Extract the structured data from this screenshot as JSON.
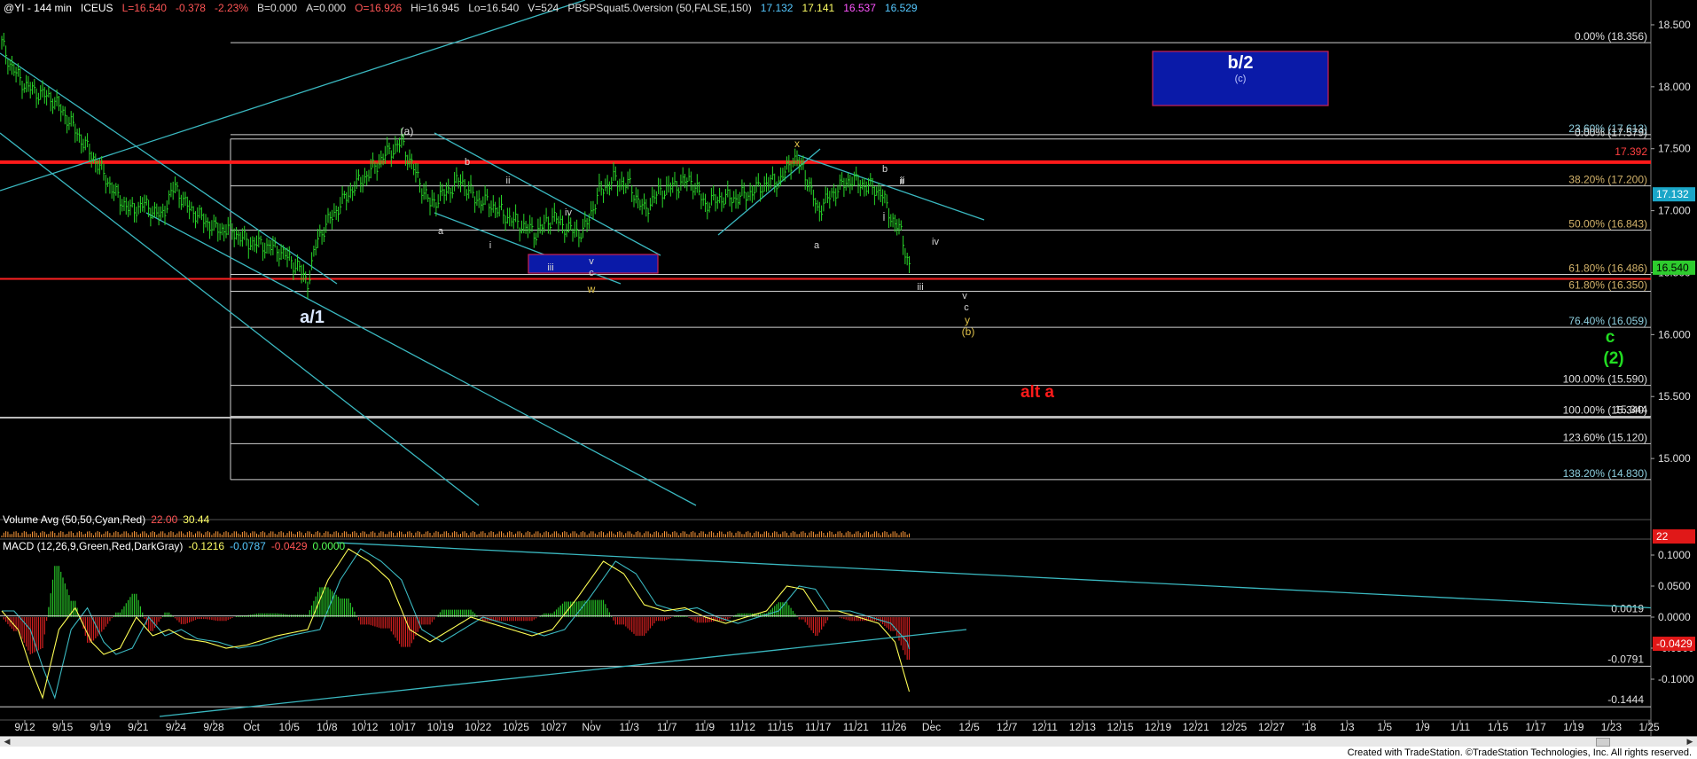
{
  "header": {
    "symbol": "@YI - 144 min",
    "exchange": "ICEUS",
    "last": "L=16.540",
    "change": "-0.378",
    "change_pct": "-2.23%",
    "bid": "B=0.000",
    "ask": "A=0.000",
    "open": "O=16.926",
    "high": "Hi=16.945",
    "low": "Lo=16.540",
    "volume": "V=524",
    "study": "PBSPSquat5.0version (50,FALSE,150)",
    "study_values": [
      "17.132",
      "17.141",
      "16.537",
      "16.529"
    ],
    "study_colors": [
      "#55c8ff",
      "#ffff66",
      "#ff55ff",
      "#55c8ff"
    ]
  },
  "volume_panel": {
    "title": "Volume Avg (50,50,Cyan,Red)",
    "value1": "22.00",
    "value2": "30.44",
    "axis_badge": "22"
  },
  "macd_panel": {
    "title": "MACD (12,26,9,Green,Red,DarkGray)",
    "value1": "-0.1216",
    "value2": "-0.0787",
    "value3": "-0.0429",
    "value4": "0.0000"
  },
  "price_axis": {
    "ticks": [
      "18.500",
      "18.000",
      "17.500",
      "17.000",
      "16.500",
      "16.000",
      "15.500",
      "15.000"
    ],
    "current_badge": "17.132",
    "last_badge": "16.540"
  },
  "macd_axis": {
    "ticks": [
      "0.1000",
      "0.0500",
      "0.0000",
      "-0.0500",
      "-0.1000"
    ],
    "badge": "-0.0429"
  },
  "fib_levels": [
    {
      "label": "0.00% (18.356)",
      "price": 18.356
    },
    {
      "label": "23.60% (17.613)",
      "price": 17.613
    },
    {
      "label": "0.00% (17.579)",
      "price": 17.579
    },
    {
      "label": "38.20% (17.200)",
      "price": 17.2
    },
    {
      "label": "50.00% (16.843)",
      "price": 16.843
    },
    {
      "label": "61.80% (16.486)",
      "price": 16.486
    },
    {
      "label": "61.80% (16.350)",
      "price": 16.35
    },
    {
      "label": "76.40% (16.059)",
      "price": 16.059
    },
    {
      "label": "100.00% (15.590)",
      "price": 15.59
    },
    {
      "label": "100.00% (15.340)",
      "price": 15.34
    },
    {
      "label": "15.344",
      "price": 15.344
    },
    {
      "label": "123.60% (15.120)",
      "price": 15.12
    },
    {
      "label": "138.20% (14.830)",
      "price": 14.83
    }
  ],
  "resistance_line": {
    "label": "17.392",
    "price": 17.392
  },
  "macd_levels": [
    "0.0019",
    "-0.0791",
    "-0.1444"
  ],
  "wave_labels": {
    "b2": "b/2",
    "c_paren": "(c)",
    "a1": "a/1",
    "alt_a": "alt a",
    "c_green": "c",
    "two_green": "(2)",
    "b_paren": "(b)",
    "a_paren": "(a)",
    "x": "x",
    "w": "w",
    "y": "y",
    "small": [
      "a",
      "b",
      "i",
      "ii",
      "iii",
      "iv",
      "v",
      "c",
      "a",
      "b",
      "i",
      "ii",
      "iii",
      "iv",
      "v",
      "c",
      "ii",
      "i"
    ]
  },
  "x_axis": [
    "9/12",
    "9/15",
    "9/19",
    "9/21",
    "9/24",
    "9/28",
    "Oct",
    "10/5",
    "10/8",
    "10/12",
    "10/17",
    "10/19",
    "10/22",
    "10/25",
    "10/27",
    "Nov",
    "11/3",
    "11/7",
    "11/9",
    "11/12",
    "11/15",
    "11/17",
    "11/21",
    "11/26",
    "Dec",
    "12/5",
    "12/7",
    "12/11",
    "12/13",
    "12/15",
    "12/19",
    "12/21",
    "12/25",
    "12/27",
    "'18",
    "1/3",
    "1/5",
    "1/9",
    "1/11",
    "1/15",
    "1/17",
    "1/19",
    "1/23",
    "1/25"
  ],
  "footer": "Created with TradeStation. ©TradeStation Technologies, Inc. All rights reserved.",
  "chart_data": {
    "type": "line",
    "title": "@YI - 144 min",
    "price_range": [
      14.55,
      18.6
    ],
    "close_path": [
      [
        0,
        18.35
      ],
      [
        5,
        18.15
      ],
      [
        12,
        18.0
      ],
      [
        18,
        17.95
      ],
      [
        25,
        17.9
      ],
      [
        32,
        17.75
      ],
      [
        40,
        17.55
      ],
      [
        48,
        17.35
      ],
      [
        55,
        17.15
      ],
      [
        63,
        17.0
      ],
      [
        70,
        17.05
      ],
      [
        78,
        16.95
      ],
      [
        85,
        17.2
      ],
      [
        90,
        17.05
      ],
      [
        97,
        16.95
      ],
      [
        105,
        16.85
      ],
      [
        112,
        16.85
      ],
      [
        120,
        16.75
      ],
      [
        128,
        16.72
      ],
      [
        136,
        16.68
      ],
      [
        145,
        16.55
      ],
      [
        150,
        16.42
      ],
      [
        155,
        16.78
      ],
      [
        163,
        16.98
      ],
      [
        172,
        17.18
      ],
      [
        180,
        17.3
      ],
      [
        188,
        17.45
      ],
      [
        196,
        17.55
      ],
      [
        203,
        17.3
      ],
      [
        210,
        17.05
      ],
      [
        218,
        17.15
      ],
      [
        225,
        17.25
      ],
      [
        232,
        17.1
      ],
      [
        240,
        17.05
      ],
      [
        248,
        16.95
      ],
      [
        255,
        16.88
      ],
      [
        262,
        16.82
      ],
      [
        270,
        16.95
      ],
      [
        278,
        16.85
      ],
      [
        285,
        16.82
      ],
      [
        293,
        17.15
      ],
      [
        300,
        17.25
      ],
      [
        308,
        17.2
      ],
      [
        315,
        17.0
      ],
      [
        322,
        17.15
      ],
      [
        330,
        17.2
      ],
      [
        338,
        17.25
      ],
      [
        345,
        17.05
      ],
      [
        352,
        17.1
      ],
      [
        360,
        17.1
      ],
      [
        368,
        17.15
      ],
      [
        375,
        17.22
      ],
      [
        382,
        17.25
      ],
      [
        388,
        17.42
      ],
      [
        393,
        17.35
      ],
      [
        400,
        17.0
      ],
      [
        408,
        17.15
      ],
      [
        416,
        17.25
      ],
      [
        424,
        17.2
      ],
      [
        431,
        17.15
      ],
      [
        436,
        16.95
      ],
      [
        441,
        16.82
      ],
      [
        445,
        16.55
      ]
    ],
    "macd": [
      [
        0,
        0.01
      ],
      [
        8,
        -0.02
      ],
      [
        14,
        -0.08
      ],
      [
        20,
        -0.13
      ],
      [
        28,
        -0.02
      ],
      [
        36,
        0.015
      ],
      [
        44,
        -0.04
      ],
      [
        50,
        -0.06
      ],
      [
        58,
        -0.05
      ],
      [
        66,
        0.0
      ],
      [
        74,
        -0.03
      ],
      [
        82,
        -0.02
      ],
      [
        90,
        -0.035
      ],
      [
        100,
        -0.04
      ],
      [
        110,
        -0.05
      ],
      [
        120,
        -0.045
      ],
      [
        135,
        -0.03
      ],
      [
        150,
        -0.02
      ],
      [
        160,
        0.06
      ],
      [
        170,
        0.11
      ],
      [
        180,
        0.09
      ],
      [
        190,
        0.06
      ],
      [
        200,
        -0.02
      ],
      [
        210,
        -0.04
      ],
      [
        220,
        -0.02
      ],
      [
        230,
        0.0
      ],
      [
        240,
        -0.01
      ],
      [
        250,
        -0.02
      ],
      [
        260,
        -0.03
      ],
      [
        270,
        -0.02
      ],
      [
        282,
        0.03
      ],
      [
        295,
        0.09
      ],
      [
        305,
        0.07
      ],
      [
        315,
        0.02
      ],
      [
        325,
        0.01
      ],
      [
        335,
        0.015
      ],
      [
        345,
        0.0
      ],
      [
        355,
        -0.01
      ],
      [
        365,
        0.0
      ],
      [
        375,
        0.01
      ],
      [
        385,
        0.05
      ],
      [
        393,
        0.045
      ],
      [
        400,
        0.01
      ],
      [
        410,
        0.01
      ],
      [
        420,
        0.0
      ],
      [
        430,
        -0.01
      ],
      [
        438,
        -0.04
      ],
      [
        445,
        -0.12
      ]
    ]
  }
}
